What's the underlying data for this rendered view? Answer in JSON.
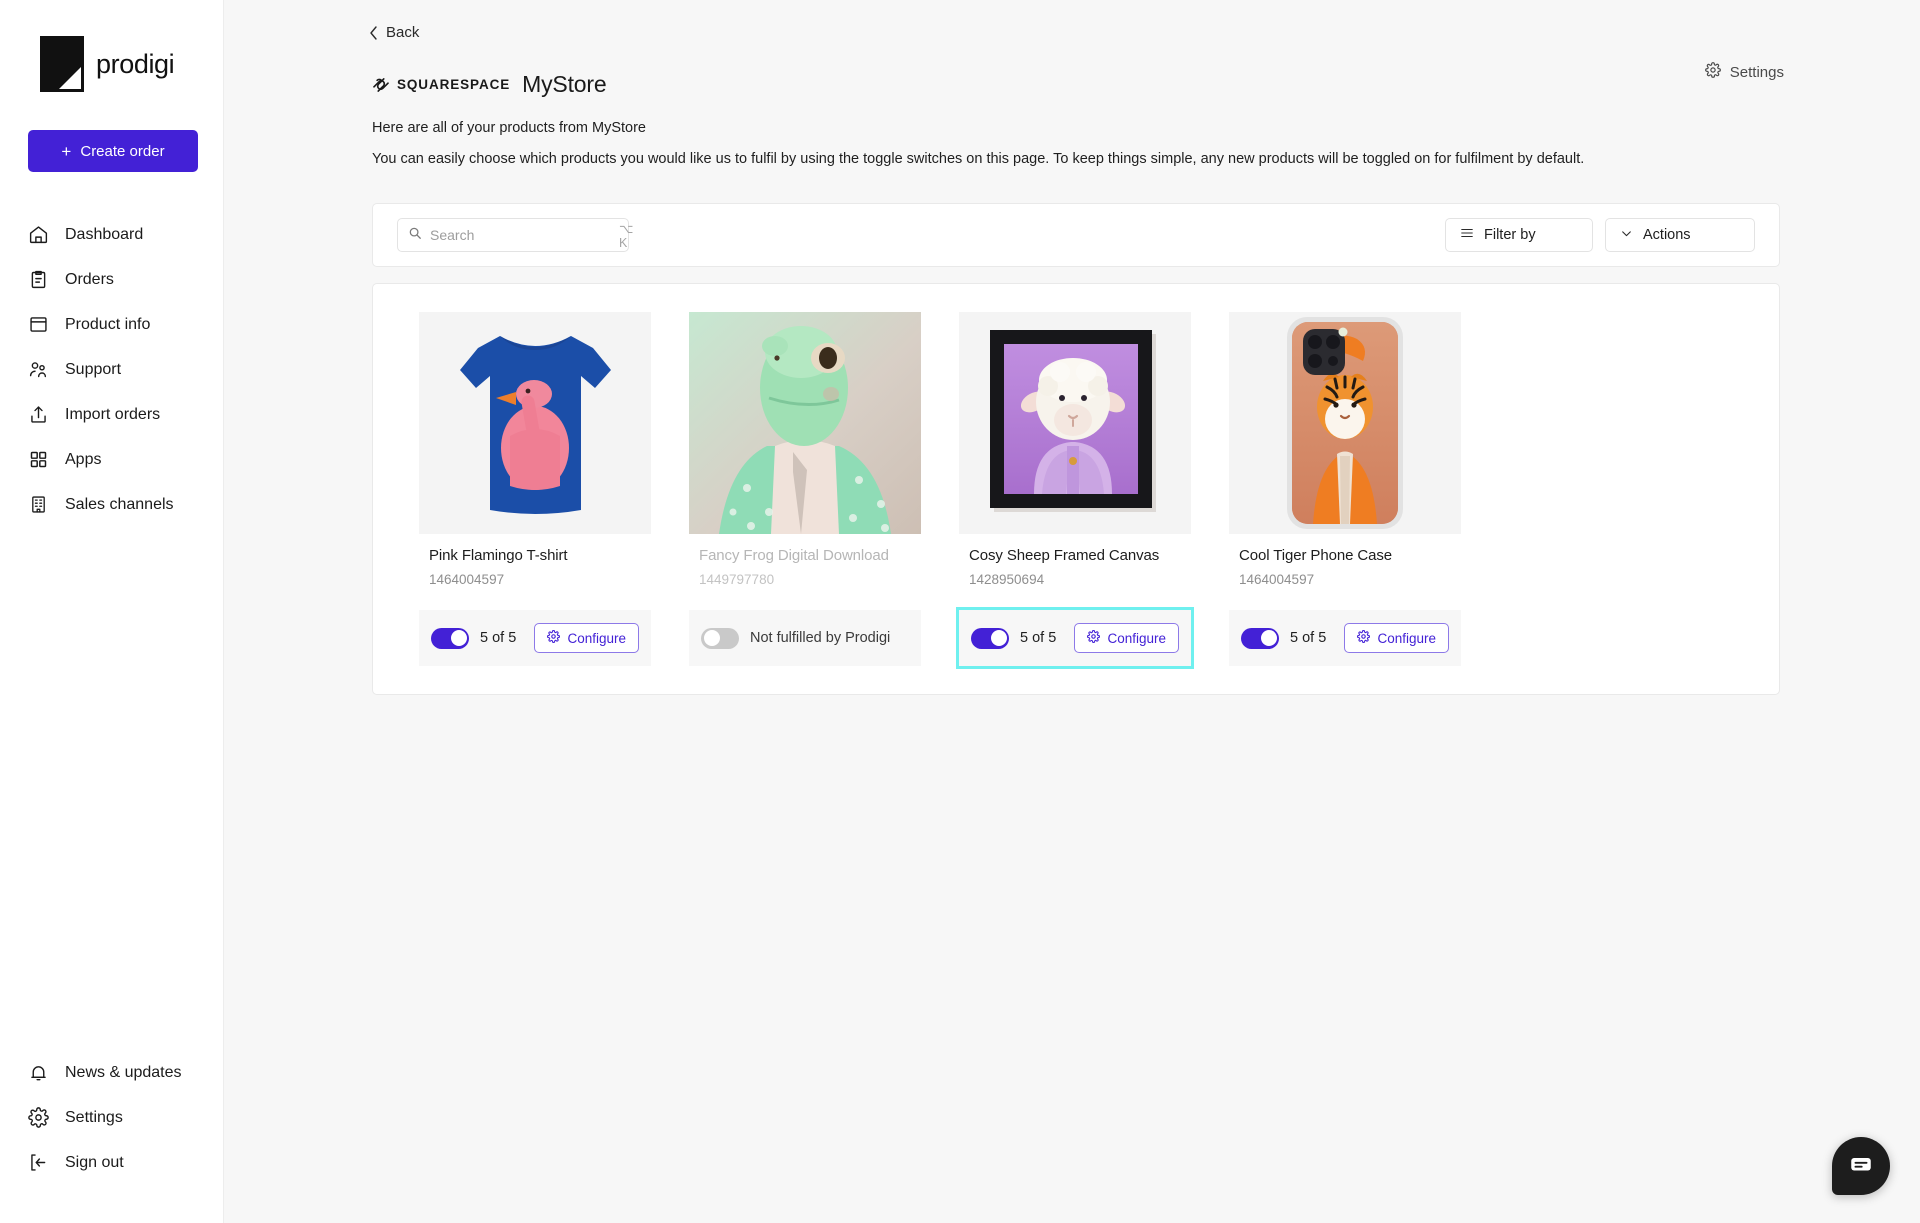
{
  "sidebar": {
    "brand": "prodigi",
    "create_order_label": "Create order",
    "items": [
      {
        "label": "Dashboard",
        "icon": "home-icon"
      },
      {
        "label": "Orders",
        "icon": "clipboard-icon"
      },
      {
        "label": "Product info",
        "icon": "box-icon"
      },
      {
        "label": "Support",
        "icon": "people-icon"
      },
      {
        "label": "Import orders",
        "icon": "upload-icon"
      },
      {
        "label": "Apps",
        "icon": "grid-icon"
      },
      {
        "label": "Sales channels",
        "icon": "building-icon"
      }
    ],
    "bottom_items": [
      {
        "label": "News & updates",
        "icon": "bell-icon"
      },
      {
        "label": "Settings",
        "icon": "gear-icon"
      },
      {
        "label": "Sign out",
        "icon": "logout-icon"
      }
    ]
  },
  "header": {
    "back_label": "Back",
    "platform": "SQUARESPACE",
    "store_name": "MyStore",
    "settings_label": "Settings",
    "sub_heading": "Here are all of your products from MyStore",
    "description": "You can easily choose which products you would like us to fulfil by using the toggle switches on this page. To keep things simple, any new products will be toggled on for fulfilment by default."
  },
  "toolbar": {
    "search_placeholder": "Search",
    "search_value": "",
    "search_shortcut": "⌥ K",
    "filter_label": "Filter by",
    "actions_label": "Actions"
  },
  "colors": {
    "brand_purple": "#4321d6",
    "highlight_cyan": "#6ff0ef",
    "panel_bg": "#ffffff",
    "page_bg": "#f7f7f7"
  },
  "products": [
    {
      "title": "Pink Flamingo T-shirt",
      "sku": "1464004597",
      "enabled": true,
      "status_label": "5 of 5",
      "action_label": "Configure",
      "highlighted": false,
      "image": "blue-tshirt-pink-flamingo"
    },
    {
      "title": "Fancy Frog Digital Download",
      "sku": "1449797780",
      "enabled": false,
      "status_label": "Not fulfilled by Prodigi",
      "action_label": "",
      "highlighted": false,
      "image": "green-frog-in-suit"
    },
    {
      "title": "Cosy Sheep Framed Canvas",
      "sku": "1428950694",
      "enabled": true,
      "status_label": "5 of 5",
      "action_label": "Configure",
      "highlighted": true,
      "image": "sheep-purple-framed-canvas"
    },
    {
      "title": "Cool Tiger Phone Case",
      "sku": "1464004597",
      "enabled": true,
      "status_label": "5 of 5",
      "action_label": "Configure",
      "highlighted": false,
      "image": "orange-tiger-phone-case"
    }
  ],
  "chat_widget": {
    "icon": "chat-bubble-icon"
  }
}
